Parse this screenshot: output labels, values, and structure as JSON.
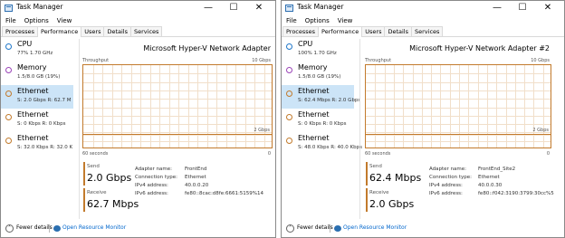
{
  "left": {
    "title": "Task Manager",
    "menus": [
      "File",
      "Options",
      "View"
    ],
    "tabs": [
      "Processes",
      "Performance",
      "Users",
      "Details",
      "Services"
    ],
    "sidebar": [
      {
        "name": "CPU",
        "sub": "77% 1.70 GHz",
        "ring": "#1f77c9"
      },
      {
        "name": "Memory",
        "sub": "1.5/8.0 GB (19%)",
        "ring": "#9b45b8"
      },
      {
        "name": "Ethernet",
        "sub": "S: 2.0 Gbps R: 62.7 M",
        "ring": "#c27a2c"
      },
      {
        "name": "Ethernet",
        "sub": "S: 0 Kbps R: 0 Kbps",
        "ring": "#c27a2c"
      },
      {
        "name": "Ethernet",
        "sub": "S: 32.0 Kbps R: 32.0 K",
        "ring": "#c27a2c"
      }
    ],
    "graph_title": "Microsoft Hyper-V Network Adapter",
    "throughput_label": "Throughput",
    "scale_top": "10 Gbps",
    "scale_mid": "2 Gbps",
    "time_left": "60 seconds",
    "time_right": "0",
    "send_label": "Send",
    "send_value": "2.0 Gbps",
    "receive_label": "Receive",
    "receive_value": "62.7 Mbps",
    "details": {
      "adapter_name_label": "Adapter name:",
      "adapter_name_value": "FrontEnd",
      "connection_type_label": "Connection type:",
      "connection_type_value": "Ethernet",
      "ipv4_label": "IPv4 address:",
      "ipv4_value": "40.0.0.20",
      "ipv6_label": "IPv6 address:",
      "ipv6_value": "fe80::8cac:d8fe:6661:5159%14"
    },
    "fewer_details": "Fewer details",
    "open_resource_monitor": "Open Resource Monitor"
  },
  "right": {
    "title": "Task Manager",
    "menus": [
      "File",
      "Options",
      "View"
    ],
    "tabs": [
      "Processes",
      "Performance",
      "Users",
      "Details",
      "Services"
    ],
    "sidebar": [
      {
        "name": "CPU",
        "sub": "100% 1.70 GHz",
        "ring": "#1f77c9"
      },
      {
        "name": "Memory",
        "sub": "1.5/8.0 GB (19%)",
        "ring": "#9b45b8"
      },
      {
        "name": "Ethernet",
        "sub": "S: 62.4 Mbps R: 2.0 Gbps",
        "ring": "#c27a2c"
      },
      {
        "name": "Ethernet",
        "sub": "S: 0 Kbps R: 0 Kbps",
        "ring": "#c27a2c"
      },
      {
        "name": "Ethernet",
        "sub": "S: 48.0 Kbps R: 40.0 Kbps",
        "ring": "#c27a2c"
      }
    ],
    "graph_title": "Microsoft Hyper-V Network Adapter #2",
    "throughput_label": "Throughput",
    "scale_top": "10 Gbps",
    "scale_mid": "2 Gbps",
    "time_left": "60 seconds",
    "time_right": "0",
    "send_label": "Send",
    "send_value": "62.4 Mbps",
    "receive_label": "Receive",
    "receive_value": "2.0 Gbps",
    "details": {
      "adapter_name_label": "Adapter name:",
      "adapter_name_value": "FrontEnd_Site2",
      "connection_type_label": "Connection type:",
      "connection_type_value": "Ethernet",
      "ipv4_label": "IPv4 address:",
      "ipv4_value": "40.0.0.30",
      "ipv6_label": "IPv6 address:",
      "ipv6_value": "fe80::f042:3190:3799:30cc%5"
    },
    "fewer_details": "Fewer details",
    "open_resource_monitor": "Open Resource Monitor"
  },
  "icons": {
    "minimize": "minimize-icon",
    "maximize": "maximize-icon",
    "close": "close-icon",
    "collapse": "chevron-up-icon",
    "monitor": "resource-monitor-icon"
  },
  "colors": {
    "ethernet": "#c27a2c",
    "selection": "#cce4f7",
    "link": "#0066cc"
  }
}
